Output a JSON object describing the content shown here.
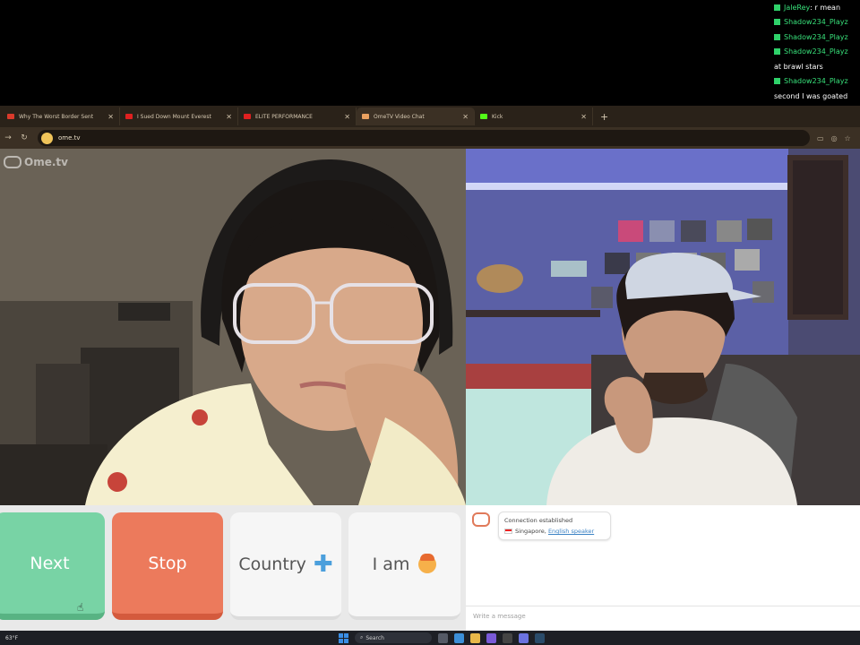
{
  "stream_chat": [
    {
      "user": "JaleRey",
      "message": ": r mean"
    },
    {
      "user": "Shadow234_Playz",
      "message": ""
    },
    {
      "user": "Shadow234_Playz",
      "message": ""
    },
    {
      "user": "Shadow234_Playz",
      "message": ""
    },
    {
      "user": "",
      "message": "at brawl stars"
    },
    {
      "user": "Shadow234_Playz",
      "message": ""
    },
    {
      "user": "",
      "message": "second I was goated"
    }
  ],
  "browser": {
    "tabs": [
      {
        "title": "Why The Worst Border Sent",
        "icon_color": "#d93a2b",
        "active": false
      },
      {
        "title": "I Sued Down Mount Everest",
        "icon_color": "#e02020",
        "active": false
      },
      {
        "title": "ELITE PERFORMANCE",
        "icon_color": "#e02020",
        "active": false
      },
      {
        "title": "OmeTV Video Chat",
        "icon_color": "#e9a060",
        "active": true
      },
      {
        "title": "Kick",
        "icon_color": "#53fc18",
        "active": false
      }
    ],
    "new_tab": "+",
    "url": "ome.tv"
  },
  "watermark": {
    "text": "Ome.tv"
  },
  "controls": {
    "next_label": "Next",
    "stop_label": "Stop",
    "country_label": "Country",
    "country_icon": "plus-icon",
    "iam_label": "I am",
    "iam_icon": "boy-face-icon"
  },
  "chat": {
    "status": "Connection established",
    "country": "Singapore",
    "language_link": "English speaker",
    "input_placeholder": "Write a message"
  },
  "taskbar": {
    "weather_temp": "63°F",
    "search_label": "Search"
  }
}
